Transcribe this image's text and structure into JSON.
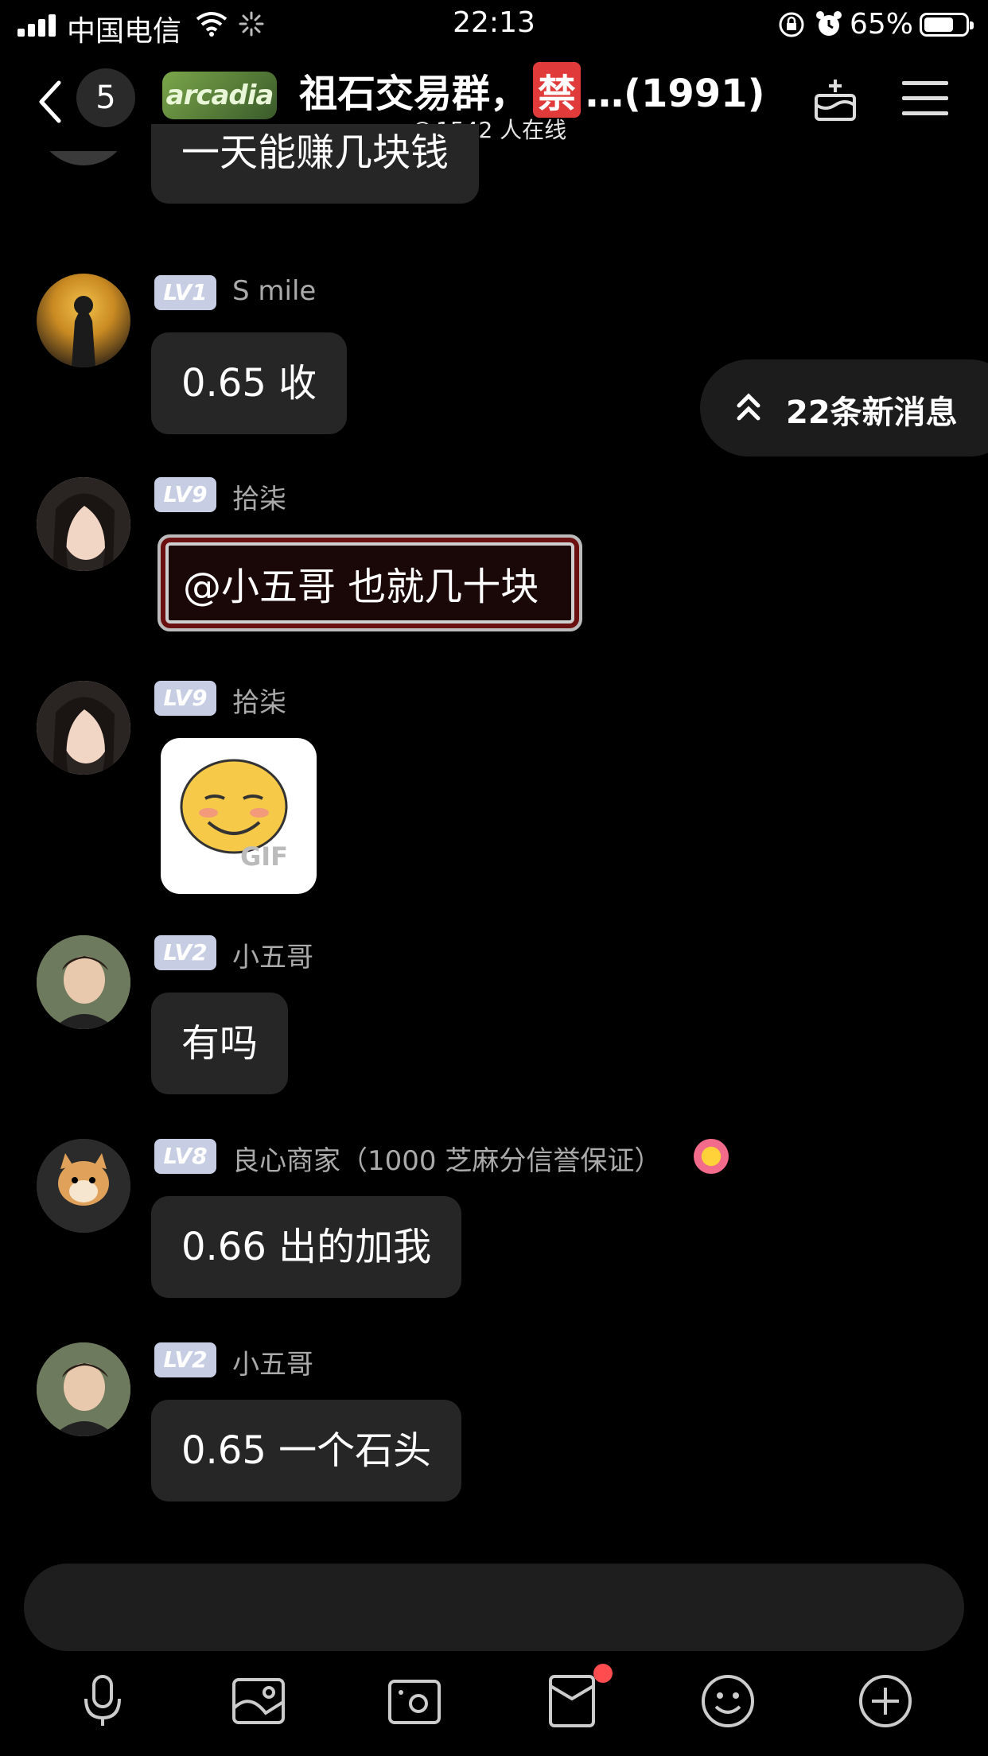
{
  "status_bar": {
    "carrier": "中国电信",
    "time": "22:13",
    "battery": "65%",
    "battery_level": 0.65
  },
  "header": {
    "unread_count": "5",
    "logo_text": "arcadia",
    "title_prefix": "祖石交易群，",
    "title_badge": "禁",
    "title_suffix": "…(1991)",
    "online": "1542 人在线",
    "icons": [
      "back-icon",
      "cake-icon",
      "menu-icon"
    ]
  },
  "new_messages": {
    "label": "22条新消息"
  },
  "messages": [
    {
      "text": "一天能赚几块钱"
    },
    {
      "level": "LV1",
      "name": "S mile",
      "text": "0.65 收"
    },
    {
      "level": "LV9",
      "name": "拾柒",
      "text": "@小五哥 也就几十块"
    },
    {
      "level": "LV9",
      "name": "拾柒",
      "sticker_label": "GIF"
    },
    {
      "level": "LV2",
      "name": "小五哥",
      "text": "有吗"
    },
    {
      "level": "LV8",
      "name": "良心商家（1000 芝麻分信誉保证）",
      "text": "0.66 出的加我"
    },
    {
      "level": "LV2",
      "name": "小五哥",
      "text": "0.65 一个石头"
    }
  ],
  "toolbar": {
    "icons": [
      "microphone-icon",
      "photo-icon",
      "camera-icon",
      "red-packet-icon",
      "emoji-icon",
      "plus-icon"
    ]
  },
  "colors": {
    "background": "#000000",
    "bubble": "#262626",
    "level_badge": "#c7cde3",
    "notification": "#ff4d4f"
  }
}
